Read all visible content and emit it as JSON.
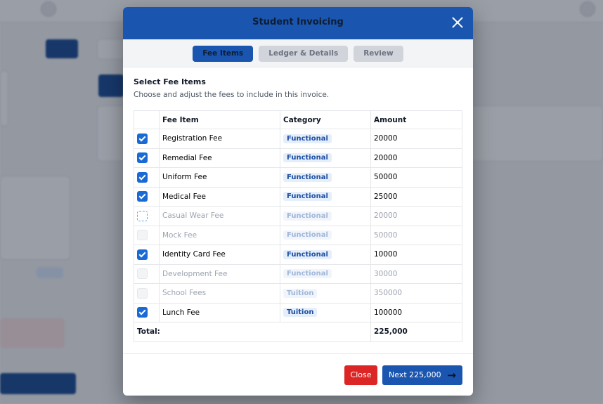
{
  "modal": {
    "title": "Student Invoicing",
    "steps": [
      {
        "label": "Fee Items",
        "active": true
      },
      {
        "label": "Ledger & Details",
        "active": false
      },
      {
        "label": "Review",
        "active": false
      }
    ],
    "section_title": "Select Fee Items",
    "section_subtitle": "Choose and adjust the fees to include in this invoice.",
    "table": {
      "headers": [
        "",
        "Fee Item",
        "Category",
        "Amount"
      ],
      "rows": [
        {
          "checked": true,
          "dim": false,
          "item": "Registration Fee",
          "category": "Functional",
          "amount": "20000"
        },
        {
          "checked": true,
          "dim": false,
          "item": "Remedial Fee",
          "category": "Functional",
          "amount": "20000"
        },
        {
          "checked": true,
          "dim": false,
          "item": "Uniform Fee",
          "category": "Functional",
          "amount": "50000"
        },
        {
          "checked": true,
          "dim": false,
          "item": "Medical Fee",
          "category": "Functional",
          "amount": "25000"
        },
        {
          "checked": false,
          "dim": true,
          "item": "Casual Wear Fee",
          "category": "Functional",
          "amount": "20000"
        },
        {
          "checked": false,
          "dim": true,
          "item": "Mock Fee",
          "category": "Functional",
          "amount": "50000"
        },
        {
          "checked": true,
          "dim": false,
          "item": "Identity Card Fee",
          "category": "Functional",
          "amount": "10000"
        },
        {
          "checked": false,
          "dim": true,
          "item": "Development Fee",
          "category": "Functional",
          "amount": "30000"
        },
        {
          "checked": false,
          "dim": true,
          "item": "School Fees",
          "category": "Tuition",
          "amount": "350000"
        },
        {
          "checked": true,
          "dim": false,
          "item": "Lunch Fee",
          "category": "Tuition",
          "amount": "100000"
        }
      ],
      "total_label": "Total:",
      "total_value": "225,000"
    },
    "footer": {
      "close_label": "Close",
      "next_label": "Next 225,000",
      "next_icon": "arrow-right-icon"
    }
  },
  "colors": {
    "primary": "#1a55b0",
    "danger": "#dc2626",
    "checkbox": "#1a6ad6"
  }
}
